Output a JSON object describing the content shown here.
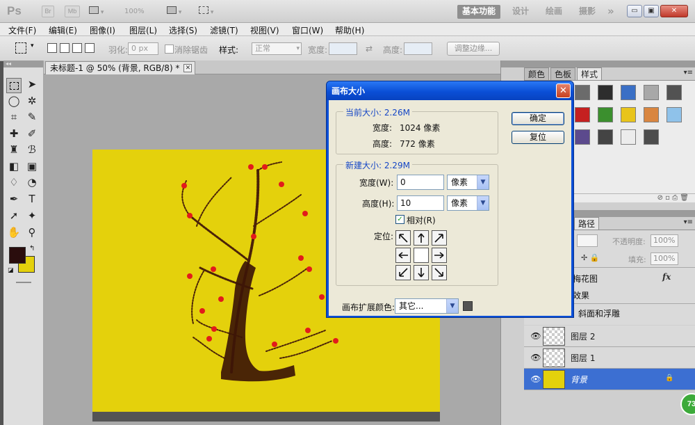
{
  "app": {
    "logo": "Ps",
    "bridge_label": "Br",
    "minibridge_label": "Mb",
    "zoom": "100%",
    "workspaces": [
      "基本功能",
      "设计",
      "绘画",
      "摄影"
    ],
    "more_workspaces": "»"
  },
  "window_controls": {
    "minimize": "▭",
    "restore": "▣",
    "close": "✕"
  },
  "menu": {
    "items": [
      "文件(F)",
      "编辑(E)",
      "图像(I)",
      "图层(L)",
      "选择(S)",
      "滤镜(T)",
      "视图(V)",
      "窗口(W)",
      "帮助(H)"
    ]
  },
  "options_bar": {
    "feather_label": "羽化:",
    "feather_value": "0 px",
    "antialias_label": "消除锯齿",
    "style_label": "样式:",
    "style_value": "正常",
    "width_label": "宽度:",
    "height_label": "高度:",
    "refine_edge": "调整边缘..."
  },
  "toolbox": {
    "grip": "◂◂",
    "tools": [
      "marquee",
      "move",
      "lasso",
      "magic-wand",
      "crop",
      "eyedropper",
      "healing",
      "brush",
      "stamp",
      "history-brush",
      "eraser",
      "gradient",
      "blur",
      "dodge",
      "pen",
      "type",
      "path-select",
      "shape",
      "hand",
      "zoom"
    ],
    "foreground_color": "#2a0d0d",
    "background_color": "#e4d10c"
  },
  "document": {
    "tab_title": "未标题-1 @ 50% (背景, RGB/8) *",
    "canvas_color": "#e4d10c",
    "strip_color": "#545454"
  },
  "right_panels": {
    "top_tabs": [
      "颜色",
      "色板",
      "样式"
    ],
    "layer_tabs": [
      "路径"
    ],
    "opacity_label": "不透明度:",
    "opacity_value": "100%",
    "fill_label": "填充:",
    "fill_value": "100%",
    "effects_layer_name": "梅花图",
    "fx_label": "fx",
    "effects_label": "效果",
    "bevel_label": "斜面和浮雕",
    "layers": [
      {
        "name": "图层 2",
        "selected": false,
        "thumb": "transparent"
      },
      {
        "name": "图层 1",
        "selected": false,
        "thumb": "transparent"
      },
      {
        "name": "背景",
        "selected": true,
        "thumb": "#e4d10c"
      }
    ]
  },
  "dialog": {
    "title": "画布大小",
    "current_size_label": "当前大小: 2.26M",
    "current_width_label": "宽度:",
    "current_width_value": "1024 像素",
    "current_height_label": "高度:",
    "current_height_value": "772 像素",
    "new_size_label": "新建大小: 2.29M",
    "width_label": "宽度(W):",
    "width_value": "0",
    "width_unit": "像素",
    "height_label": "高度(H):",
    "height_value": "10",
    "height_unit": "像素",
    "relative_label": "相对(R)",
    "relative_checked": "✓",
    "anchor_label": "定位:",
    "extension_color_label": "画布扩展颜色:",
    "extension_color_value": "其它...",
    "extension_swatch": "#535353",
    "ok_button": "确定",
    "reset_button": "复位"
  },
  "overlay_badge": "73"
}
